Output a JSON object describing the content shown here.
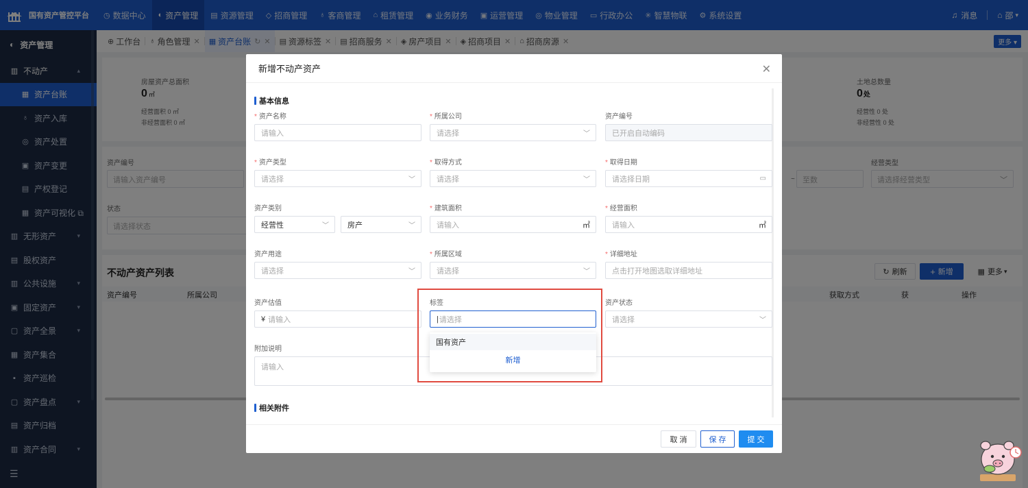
{
  "topnav": {
    "brand": "国有资产管控平台",
    "items": [
      {
        "icon": "◷",
        "label": "数据中心"
      },
      {
        "icon": "◐",
        "label": "资产管理"
      },
      {
        "icon": "▤",
        "label": "资源管理"
      },
      {
        "icon": "◇",
        "label": "招商管理"
      },
      {
        "icon": "♁",
        "label": "客商管理"
      },
      {
        "icon": "⌂",
        "label": "租赁管理"
      },
      {
        "icon": "◉",
        "label": "业务财务"
      },
      {
        "icon": "▣",
        "label": "运营管理"
      },
      {
        "icon": "◎",
        "label": "物业管理"
      },
      {
        "icon": "▭",
        "label": "行政办公"
      },
      {
        "icon": "✳",
        "label": "智慧物联"
      },
      {
        "icon": "⚙",
        "label": "系统设置"
      }
    ],
    "messages": "消息",
    "user": "邵"
  },
  "sidebar": {
    "title": "资产管理",
    "items": [
      {
        "icon": "▥",
        "label": "不动产",
        "chev": "▴"
      },
      {
        "icon": "▦",
        "label": "资产台账"
      },
      {
        "icon": "♁",
        "label": "资产入库"
      },
      {
        "icon": "◎",
        "label": "资产处置"
      },
      {
        "icon": "▣",
        "label": "资产变更"
      },
      {
        "icon": "▤",
        "label": "产权登记"
      },
      {
        "icon": "▦",
        "label": "资产可视化 ⧉"
      },
      {
        "icon": "▥",
        "label": "无形资产",
        "chev": "▾"
      },
      {
        "icon": "▤",
        "label": "股权资产"
      },
      {
        "icon": "▥",
        "label": "公共设施",
        "chev": "▾"
      },
      {
        "icon": "▣",
        "label": "固定资产",
        "chev": "▾"
      },
      {
        "icon": "▢",
        "label": "资产全景",
        "chev": "▾"
      },
      {
        "icon": "▦",
        "label": "资产集合"
      },
      {
        "icon": "▪",
        "label": "资产巡检"
      },
      {
        "icon": "▢",
        "label": "资产盘点",
        "chev": "▾"
      },
      {
        "icon": "▤",
        "label": "资产归档"
      },
      {
        "icon": "▥",
        "label": "资产合同",
        "chev": "▾"
      }
    ],
    "menu_toggle": "☰"
  },
  "tabs": [
    {
      "icon": "⊕",
      "label": "工作台"
    },
    {
      "icon": "♁",
      "label": "角色管理"
    },
    {
      "icon": "▦",
      "label": "资产台账",
      "active": true
    },
    {
      "icon": "▤",
      "label": "资源标签"
    },
    {
      "icon": "▤",
      "label": "招商服务"
    },
    {
      "icon": "◈",
      "label": "房产项目"
    },
    {
      "icon": "◈",
      "label": "招商项目"
    },
    {
      "icon": "⌂",
      "label": "招商房源"
    }
  ],
  "tabs_more": "更多 ▾",
  "stats": {
    "house_area_label": "房屋资产总面积",
    "house_area_value": "0",
    "house_area_unit": "㎡",
    "house_op": "经营面积 0 ㎡",
    "house_nonop": "非经营面积 0 ㎡",
    "land_label": "土地总数量",
    "land_value": "0",
    "land_unit": "处",
    "land_op": "经营性 0 处",
    "land_nonop": "非经营性 0 处"
  },
  "filters": {
    "asset_no_label": "资产编号",
    "asset_no_placeholder": "请输入资产编号",
    "status_label": "状态",
    "status_placeholder": "请选择状态",
    "range_to": "至数",
    "op_type_label": "经营类型",
    "op_type_placeholder": "请选择经营类型"
  },
  "list": {
    "title": "不动产资产列表",
    "refresh": "刷新",
    "add": "新增",
    "more": "更多",
    "columns": [
      "资产编号",
      "所属公司",
      "获取方式",
      "获",
      "操作"
    ]
  },
  "modal": {
    "title": "新增不动产资产",
    "section_basic": "基本信息",
    "section_attach": "相关附件",
    "fields": {
      "name_label": "资产名称",
      "name_ph": "请输入",
      "company_label": "所属公司",
      "company_ph": "请选择",
      "code_label": "资产编号",
      "code_ph": "已开启自动编码",
      "type_label": "资产类型",
      "type_ph": "请选择",
      "acquire_label": "取得方式",
      "acquire_ph": "请选择",
      "date_label": "取得日期",
      "date_ph": "请选择日期",
      "category_label": "资产类别",
      "category_v1": "经营性",
      "category_v2": "房产",
      "build_area_label": "建筑面积",
      "build_area_ph": "请输入",
      "area_unit": "㎡",
      "op_area_label": "经营面积",
      "op_area_ph": "请输入",
      "usage_label": "资产用途",
      "usage_ph": "请选择",
      "region_label": "所属区域",
      "region_ph": "请选择",
      "address_label": "详细地址",
      "address_ph": "点击打开地图选取详细地址",
      "value_label": "资产估值",
      "value_prefix": "¥",
      "value_ph": "请输入",
      "tag_label": "标签",
      "tag_ph": "请选择",
      "status_label": "资产状态",
      "status_ph": "请选择",
      "note_label": "附加说明",
      "note_ph": "请输入"
    },
    "tag_dropdown": {
      "option": "国有资产",
      "add": "新增"
    },
    "buttons": {
      "cancel": "取 消",
      "save": "保 存",
      "submit": "提 交"
    }
  },
  "colors": {
    "primary": "#1f5fd0",
    "sidebar": "#1d2b44",
    "highlight": "#e04a3f"
  }
}
